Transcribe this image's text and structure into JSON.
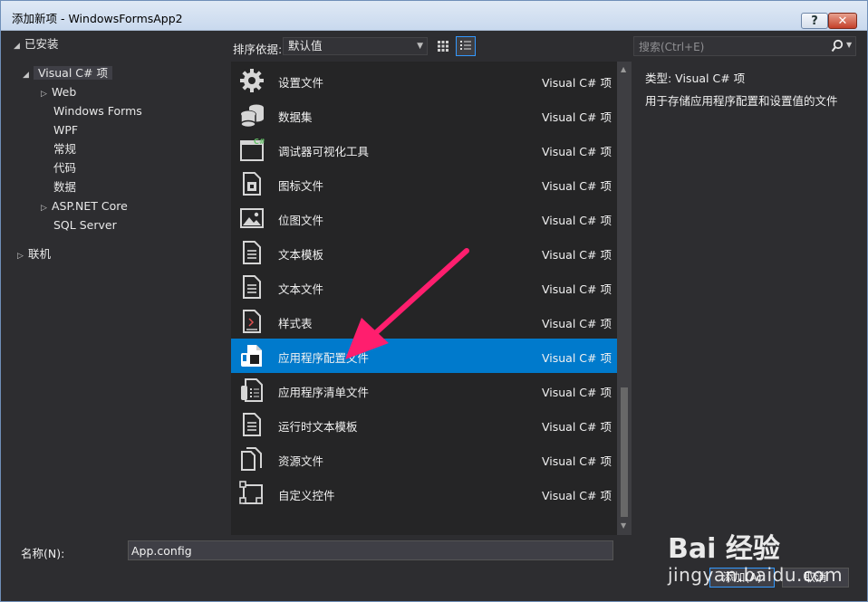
{
  "window": {
    "title": "添加新项 - WindowsFormsApp2",
    "help_label": "?",
    "close_label": "✕"
  },
  "tree": {
    "installed": "已安装",
    "visual_csharp": "Visual C# 项",
    "children": [
      "Web",
      "Windows Forms",
      "WPF",
      "常规",
      "代码",
      "数据",
      "ASP.NET Core",
      "SQL Server"
    ],
    "online": "联机"
  },
  "toolbar": {
    "sort_label": "排序依据:",
    "sort_value": "默认值"
  },
  "search": {
    "placeholder": "搜索(Ctrl+E)"
  },
  "items": [
    {
      "name": "设置文件",
      "type": "Visual C# 项",
      "icon": "gear-icon"
    },
    {
      "name": "数据集",
      "type": "Visual C# 项",
      "icon": "database-icon"
    },
    {
      "name": "调试器可视化工具",
      "type": "Visual C# 项",
      "icon": "window-csharp-icon",
      "badge": "C#"
    },
    {
      "name": "图标文件",
      "type": "Visual C# 项",
      "icon": "icon-file-icon"
    },
    {
      "name": "位图文件",
      "type": "Visual C# 项",
      "icon": "bitmap-icon"
    },
    {
      "name": "文本模板",
      "type": "Visual C# 项",
      "icon": "text-template-icon"
    },
    {
      "name": "文本文件",
      "type": "Visual C# 项",
      "icon": "text-file-icon"
    },
    {
      "name": "样式表",
      "type": "Visual C# 项",
      "icon": "stylesheet-icon"
    },
    {
      "name": "应用程序配置文件",
      "type": "Visual C# 项",
      "icon": "config-file-icon"
    },
    {
      "name": "应用程序清单文件",
      "type": "Visual C# 项",
      "icon": "manifest-file-icon"
    },
    {
      "name": "运行时文本模板",
      "type": "Visual C# 项",
      "icon": "runtime-template-icon"
    },
    {
      "name": "资源文件",
      "type": "Visual C# 项",
      "icon": "resource-file-icon"
    },
    {
      "name": "自定义控件",
      "type": "Visual C# 项",
      "icon": "custom-control-icon"
    }
  ],
  "selected_index": 8,
  "details": {
    "type_line": "类型:  Visual C# 项",
    "description": "用于存储应用程序配置和设置值的文件"
  },
  "bottom": {
    "name_label": "名称(N):",
    "name_value": "App.config",
    "add_label": "添加(A)",
    "cancel_label": "取消"
  },
  "watermark": {
    "brand": "Bai 经验",
    "url": "jingyan.baidu.com"
  },
  "colors": {
    "selection": "#007acc",
    "annotation_arrow": "#ff1e6e",
    "background": "#2d2d30"
  }
}
